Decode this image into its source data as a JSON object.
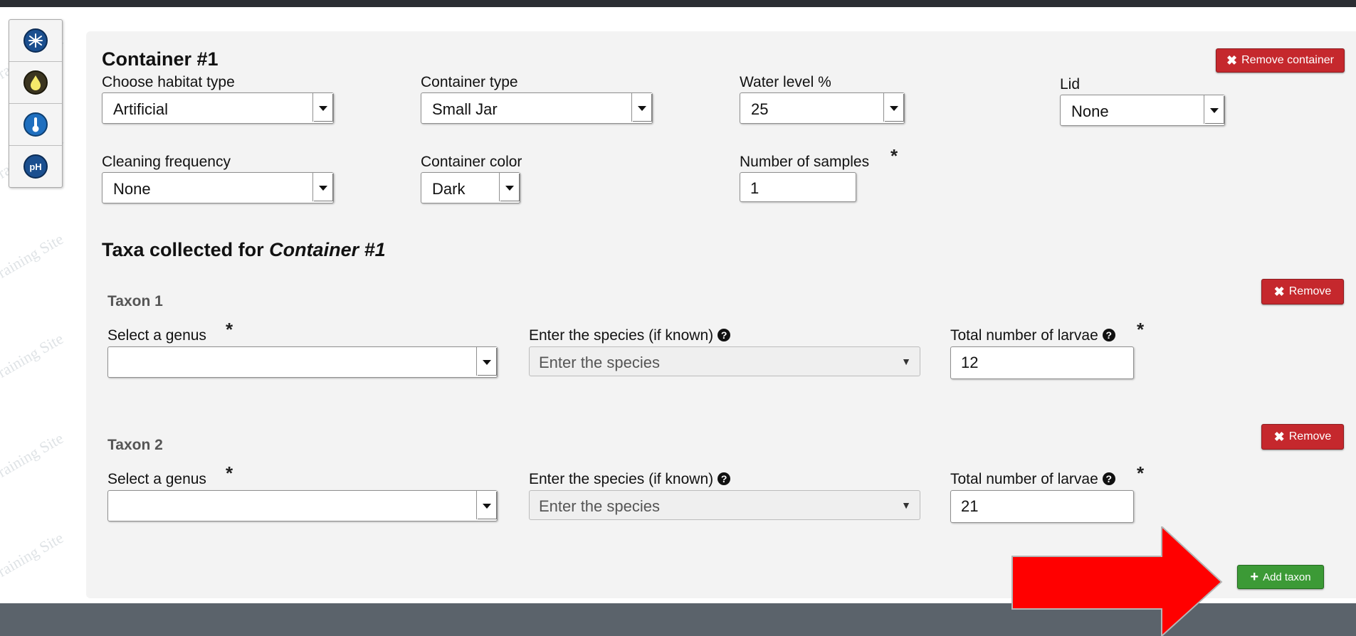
{
  "toolbar": {
    "tools": [
      {
        "icon": "mosquito-icon"
      },
      {
        "icon": "water-drop-icon"
      },
      {
        "icon": "thermometer-icon"
      },
      {
        "icon": "ph-icon",
        "text": "pH"
      }
    ]
  },
  "container": {
    "title": "Container #1",
    "remove_label": "Remove container",
    "habitat": {
      "label": "Choose habitat type",
      "value": "Artificial"
    },
    "container_type": {
      "label": "Container type",
      "value": "Small Jar"
    },
    "water_level": {
      "label": "Water level %",
      "value": "25"
    },
    "lid": {
      "label": "Lid",
      "value": "None"
    },
    "cleaning": {
      "label": "Cleaning frequency",
      "value": "None"
    },
    "color": {
      "label": "Container color",
      "value": "Dark"
    },
    "samples": {
      "label": "Number of samples",
      "required": "*",
      "value": "1"
    }
  },
  "taxa": {
    "heading_prefix": "Taxa collected for ",
    "heading_container": "Container #1",
    "items": [
      {
        "title": "Taxon 1",
        "remove_label": "Remove",
        "genus_label": "Select a genus",
        "genus_value": "",
        "species_label": "Enter the species (if known)",
        "species_placeholder": "Enter the species",
        "larvae_label": "Total number of larvae",
        "larvae_value": "12"
      },
      {
        "title": "Taxon 2",
        "remove_label": "Remove",
        "genus_label": "Select a genus",
        "genus_value": "",
        "species_label": "Enter the species (if known)",
        "species_placeholder": "Enter the species",
        "larvae_label": "Total number of larvae",
        "larvae_value": "21"
      }
    ],
    "add_label": "Add taxon"
  },
  "watermark": {
    "text": "Training Site"
  },
  "colors": {
    "danger": "#c5282d",
    "success": "#3c9a36",
    "arrow": "#ff0000",
    "panel": "#f3f3f3"
  }
}
